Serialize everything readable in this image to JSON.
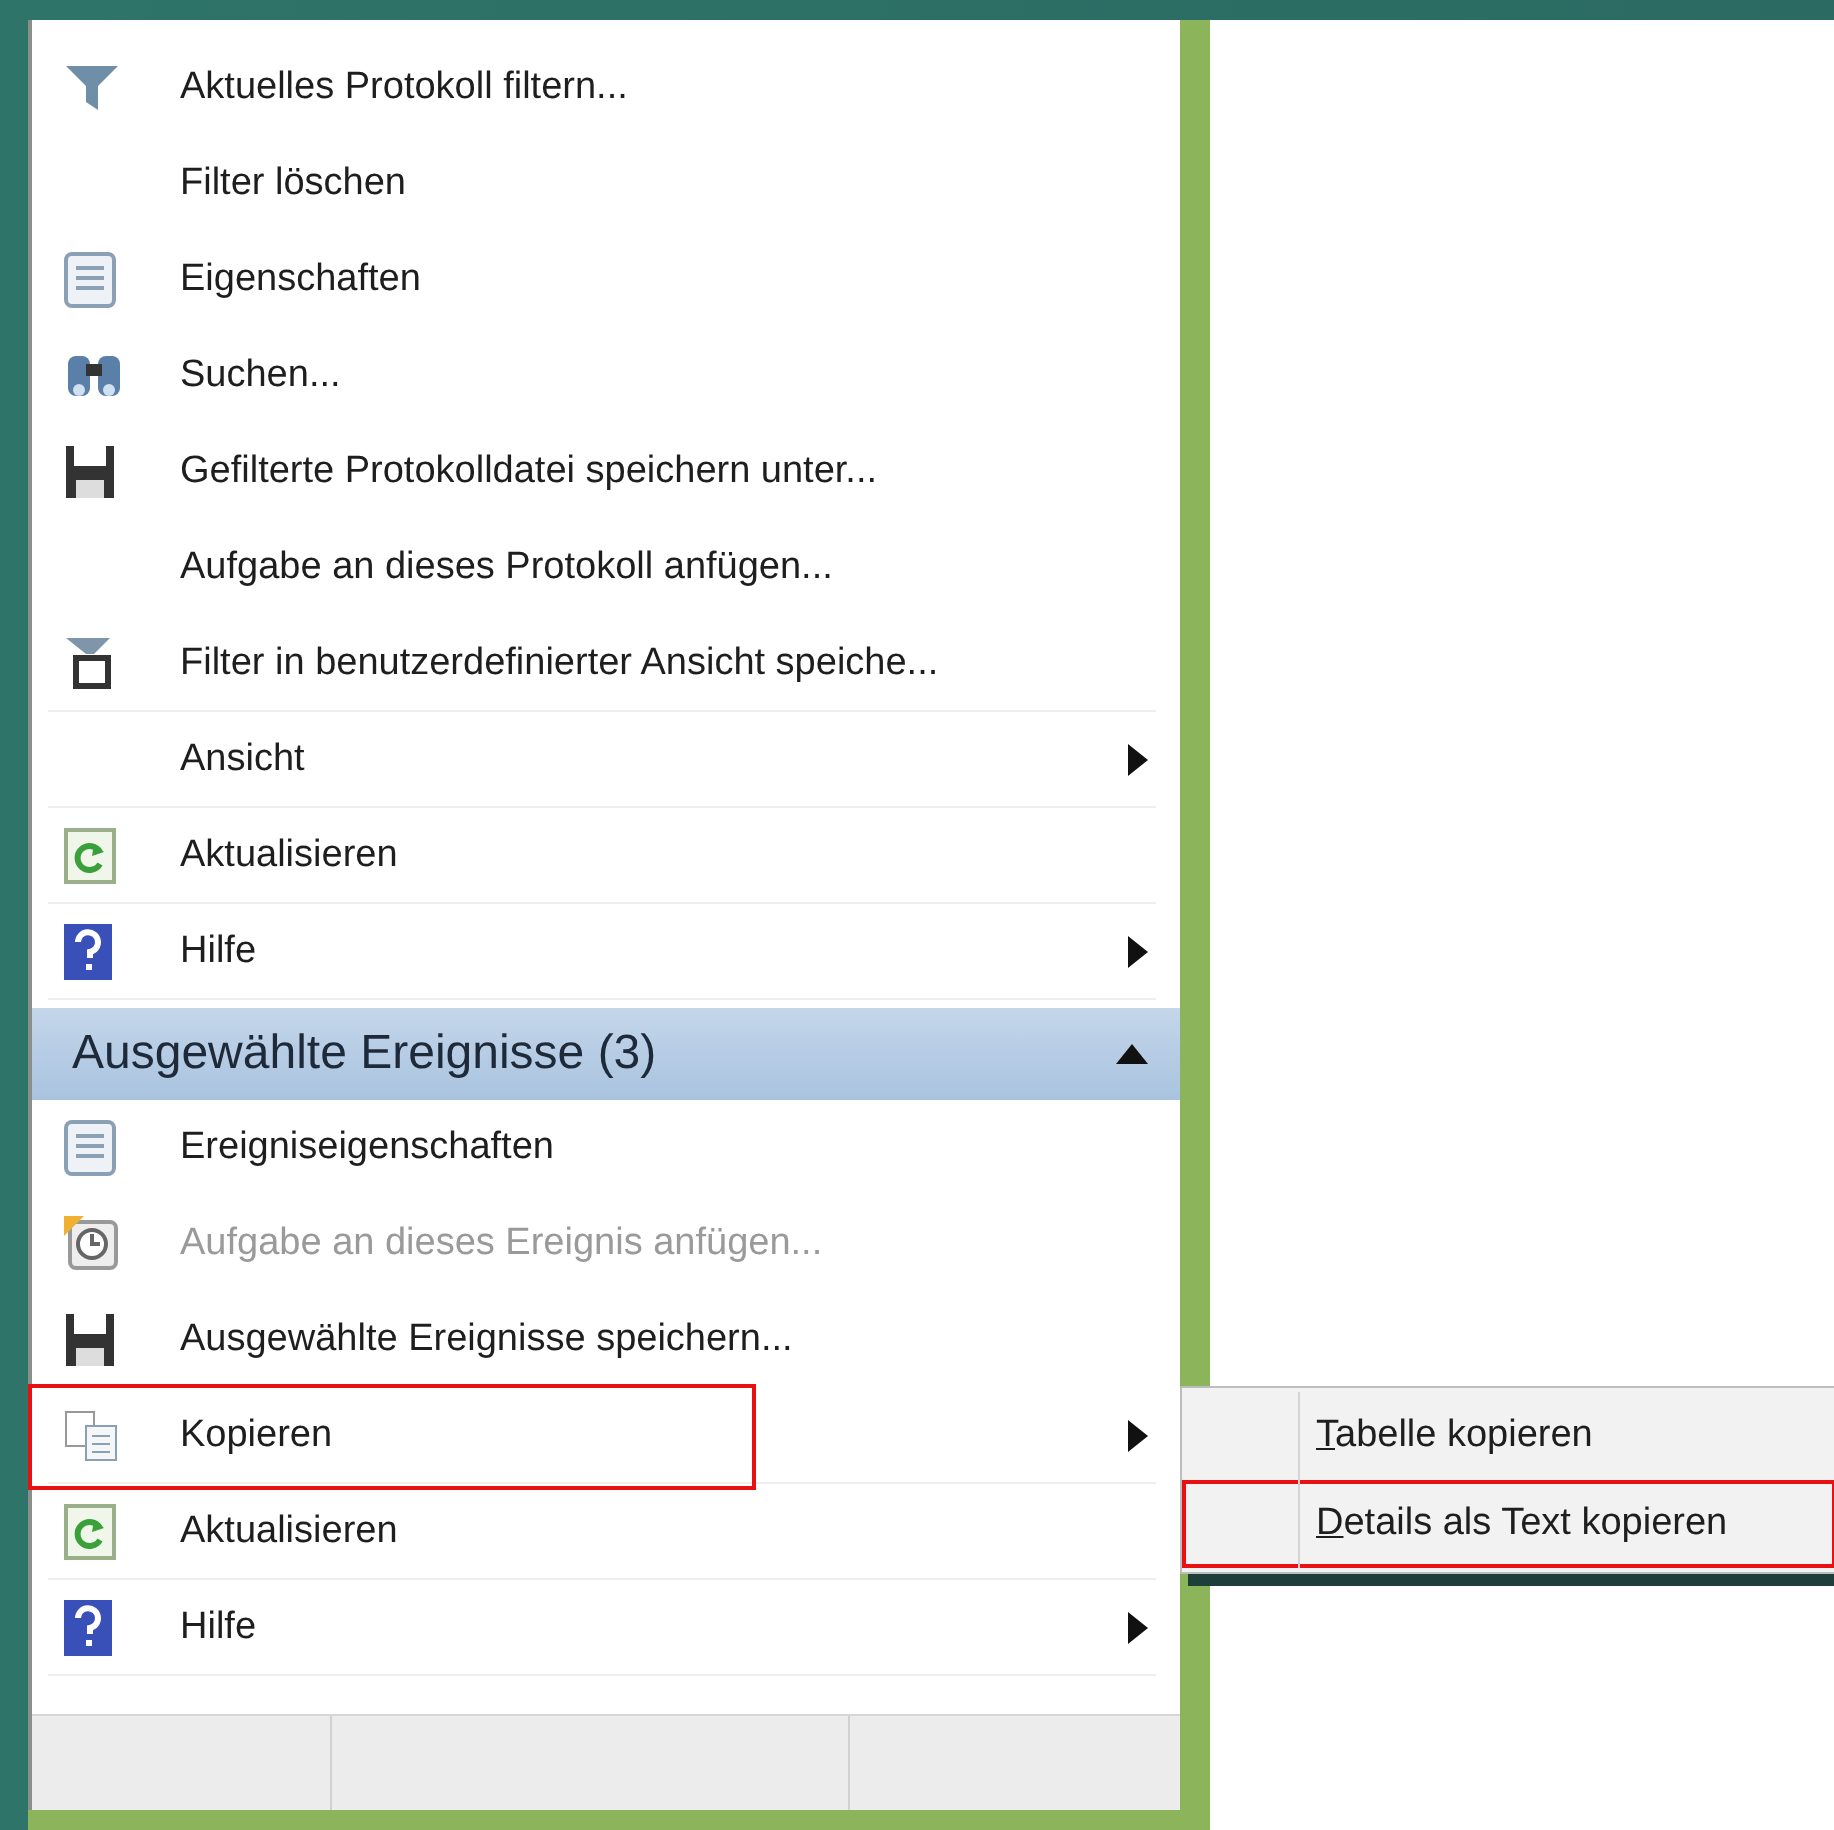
{
  "actions": [
    {
      "kind": "filter",
      "label": "Aktuelles Protokoll filtern...",
      "disabled": false,
      "has_submenu": false,
      "highlighted": false
    },
    {
      "kind": "plain",
      "label": "Filter löschen",
      "disabled": false,
      "has_submenu": false,
      "highlighted": false
    },
    {
      "kind": "properties",
      "label": "Eigenschaften",
      "disabled": false,
      "has_submenu": false,
      "highlighted": false
    },
    {
      "kind": "search",
      "label": "Suchen...",
      "disabled": false,
      "has_submenu": false,
      "highlighted": false
    },
    {
      "kind": "save",
      "label": "Gefilterte Protokolldatei speichern unter...",
      "disabled": false,
      "has_submenu": false,
      "highlighted": false
    },
    {
      "kind": "plain",
      "label": "Aufgabe an dieses Protokoll anfügen...",
      "disabled": false,
      "has_submenu": false,
      "highlighted": false
    },
    {
      "kind": "filtersave",
      "label": "Filter in benutzerdefinierter Ansicht speiche...",
      "disabled": false,
      "has_submenu": false,
      "highlighted": false
    },
    {
      "kind": "plain",
      "label": "Ansicht",
      "disabled": false,
      "has_submenu": true,
      "highlighted": false
    },
    {
      "kind": "refresh",
      "label": "Aktualisieren",
      "disabled": false,
      "has_submenu": false,
      "highlighted": false
    },
    {
      "kind": "help",
      "label": "Hilfe",
      "disabled": false,
      "has_submenu": true,
      "highlighted": false
    }
  ],
  "section": {
    "title": "Ausgewählte Ereignisse (3)",
    "expanded": true,
    "items": [
      {
        "kind": "properties",
        "label": "Ereigniseigenschaften",
        "disabled": false,
        "has_submenu": false,
        "highlighted": false
      },
      {
        "kind": "task",
        "label": "Aufgabe an dieses Ereignis anfügen...",
        "disabled": true,
        "has_submenu": false,
        "highlighted": false
      },
      {
        "kind": "save",
        "label": "Ausgewählte Ereignisse speichern...",
        "disabled": false,
        "has_submenu": false,
        "highlighted": false
      },
      {
        "kind": "copy",
        "label": "Kopieren",
        "disabled": false,
        "has_submenu": true,
        "highlighted": true
      },
      {
        "kind": "refresh",
        "label": "Aktualisieren",
        "disabled": false,
        "has_submenu": false,
        "highlighted": false
      },
      {
        "kind": "help",
        "label": "Hilfe",
        "disabled": false,
        "has_submenu": true,
        "highlighted": false
      }
    ]
  },
  "submenu": [
    {
      "label": "Tabelle kopieren",
      "mnemonic_underlined": true,
      "highlighted": false
    },
    {
      "label": "Details als Text kopieren",
      "mnemonic_underlined": true,
      "highlighted": true
    }
  ]
}
